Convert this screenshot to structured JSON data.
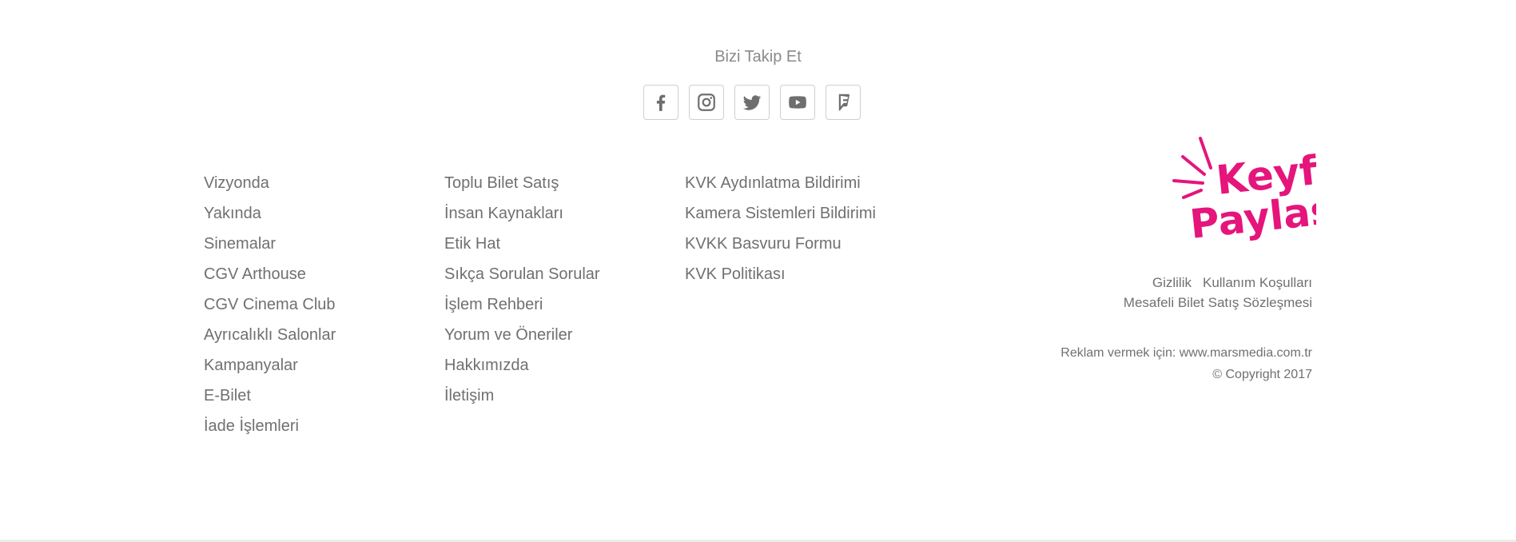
{
  "follow": {
    "title": "Bizi Takip Et",
    "icons": [
      "facebook-icon",
      "instagram-icon",
      "twitter-icon",
      "youtube-icon",
      "foursquare-icon"
    ]
  },
  "links": {
    "col1": [
      "Vizyonda",
      "Yakında",
      "Sinemalar",
      "CGV Arthouse",
      "CGV Cinema Club",
      "Ayrıcalıklı Salonlar",
      "Kampanyalar",
      "E-Bilet",
      "İade İşlemleri"
    ],
    "col2": [
      "Toplu Bilet Satış",
      "İnsan Kaynakları",
      "Etik Hat",
      "Sıkça Sorulan Sorular",
      "İşlem Rehberi",
      "Yorum ve Öneriler",
      "Hakkımızda",
      "İletişim"
    ],
    "col3": [
      "KVK Aydınlatma Bildirimi",
      "Kamera Sistemleri Bildirimi",
      "KVKK Basvuru Formu",
      "KVK Politikası"
    ]
  },
  "logo": {
    "line1": "Keyfi",
    "line2": "Paylaş",
    "color": "#e5157c"
  },
  "legal": {
    "privacy": "Gizlilik",
    "terms": "Kullanım Koşulları",
    "contract": "Mesafeli Bilet Satış Sözleşmesi"
  },
  "advert": "Reklam vermek için: www.marsmedia.com.tr",
  "copyright": "© Copyright 2017"
}
